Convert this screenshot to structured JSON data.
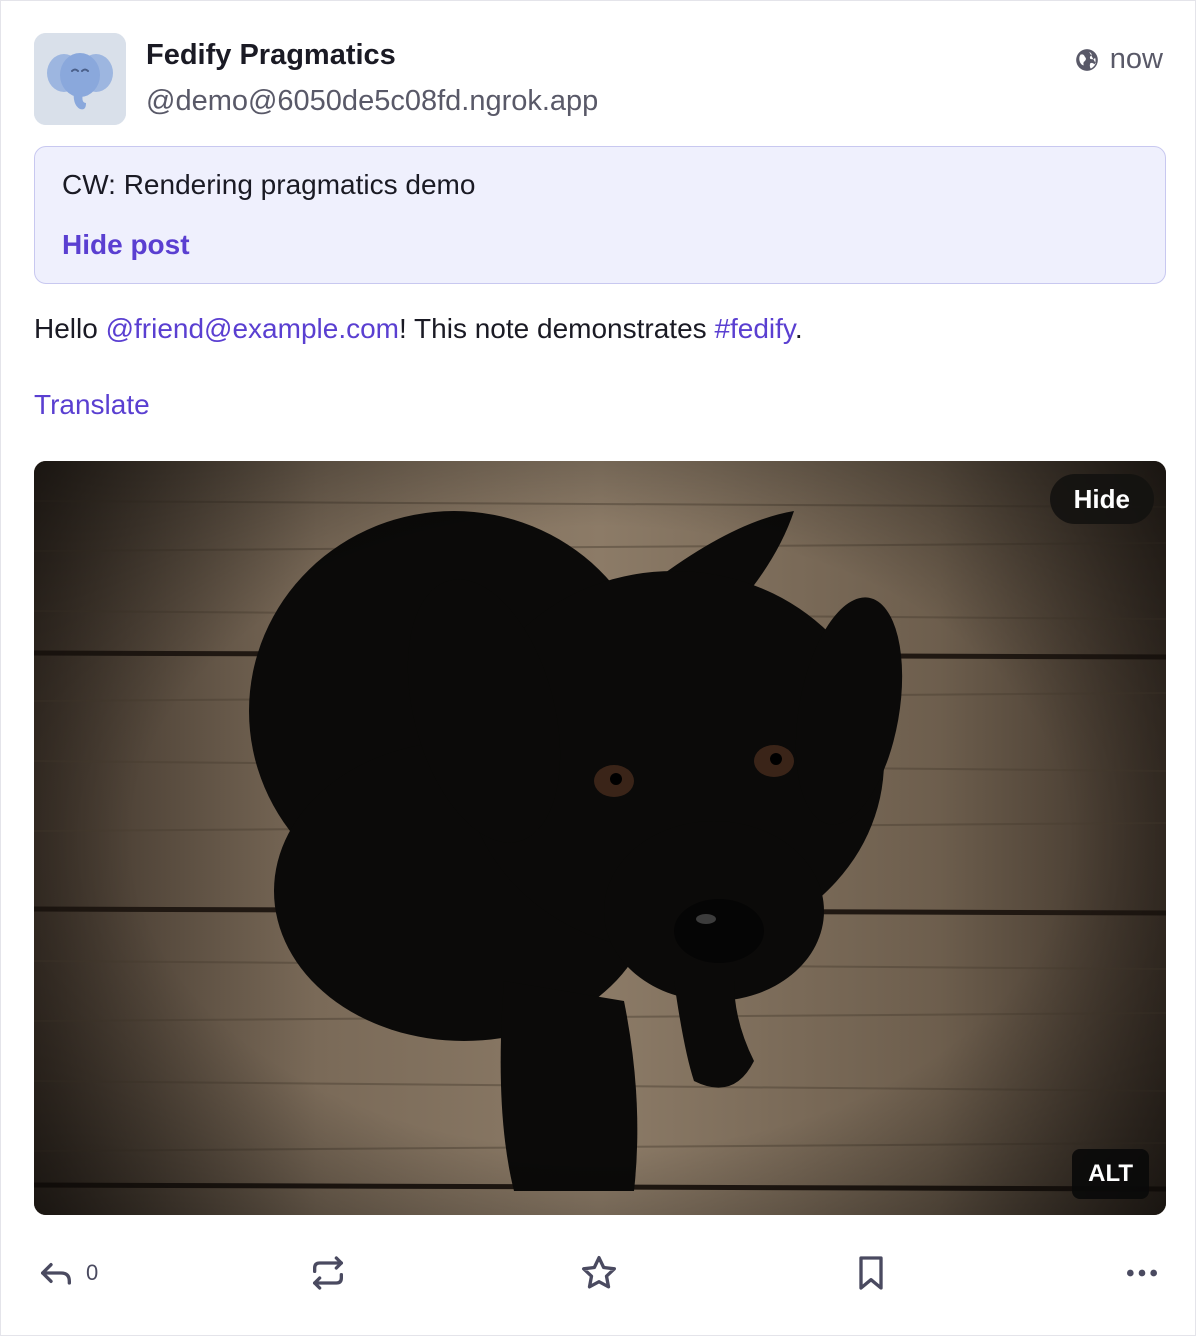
{
  "author": {
    "display_name": "Fedify Pragmatics",
    "handle": "@demo@6050de5c08fd.ngrok.app",
    "avatar_icon": "elephant-icon"
  },
  "meta": {
    "visibility_icon": "globe-icon",
    "timestamp": "now"
  },
  "content_warning": {
    "text": "CW: Rendering pragmatics demo",
    "toggle_label": "Hide post"
  },
  "content": {
    "prefix": "Hello ",
    "mention": "@friend@example.com",
    "middle": "! This note demonstrates ",
    "hashtag": "#fedify",
    "suffix": "."
  },
  "translate_label": "Translate",
  "media": {
    "hide_label": "Hide",
    "alt_label": "ALT"
  },
  "actions": {
    "reply_count": "0"
  },
  "colors": {
    "accent": "#5a3fd1",
    "cw_background": "#eff0fd",
    "cw_border": "#c8c8f0",
    "muted_text": "#595968"
  }
}
